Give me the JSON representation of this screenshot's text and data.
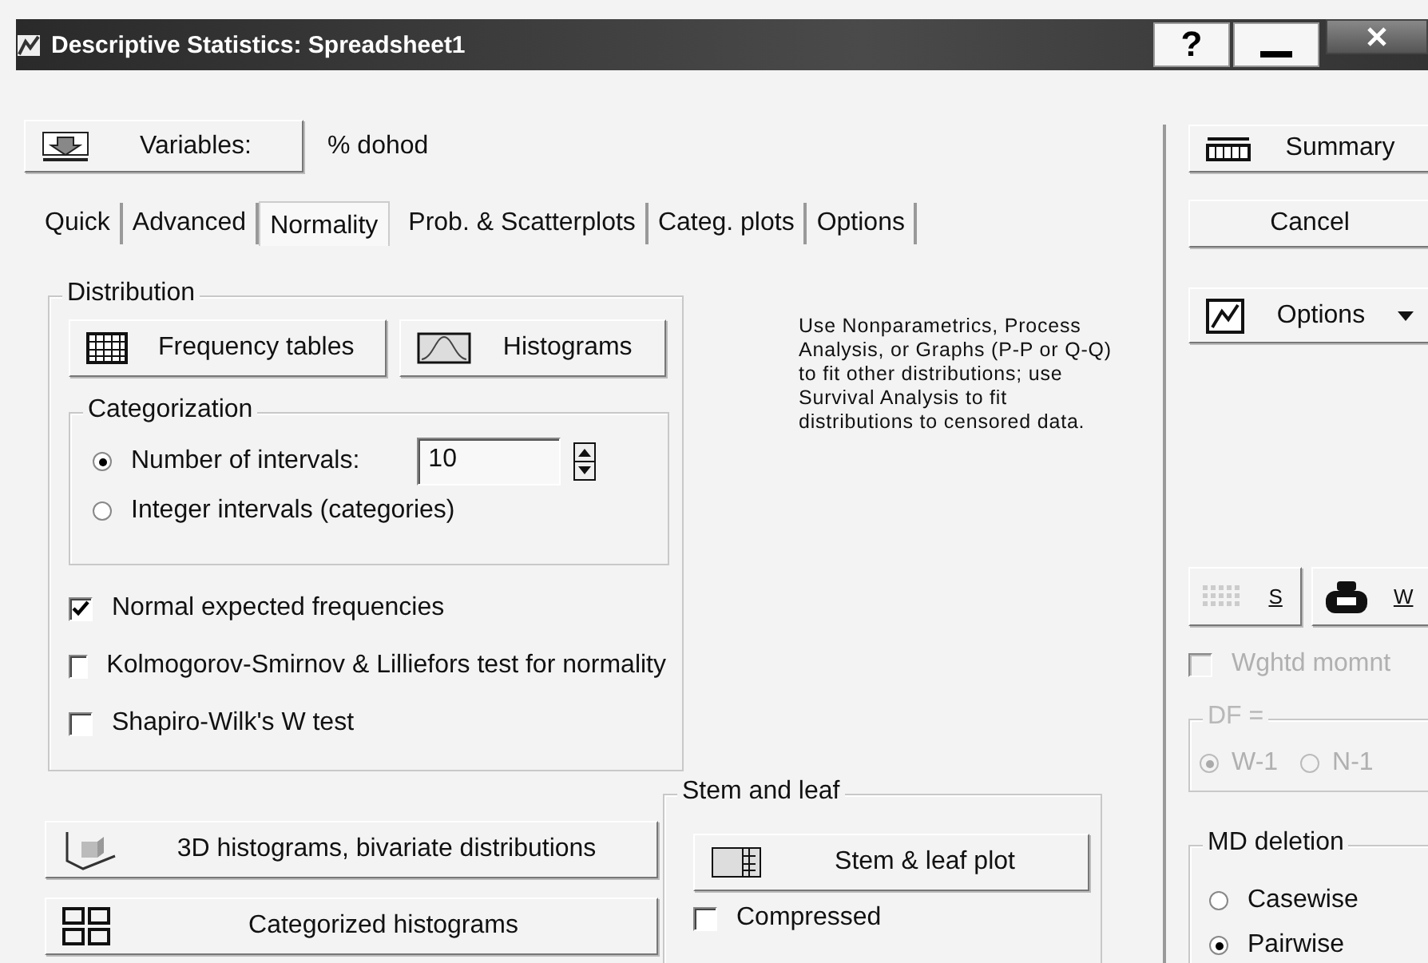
{
  "window": {
    "title": "Descriptive Statistics: Spreadsheet1",
    "help_button": "?"
  },
  "variables_button": "Variables:",
  "variables_value": "% dohod",
  "tabs": [
    {
      "label": "Quick",
      "selected": false
    },
    {
      "label": "Advanced",
      "selected": false
    },
    {
      "label": "Normality",
      "selected": true
    },
    {
      "label": "Prob. & Scatterplots",
      "selected": false
    },
    {
      "label": "Categ. plots",
      "selected": false
    },
    {
      "label": "Options",
      "selected": false
    }
  ],
  "distribution": {
    "title": "Distribution",
    "buttons": [
      "Frequency tables",
      "Histograms"
    ],
    "categorization": {
      "title": "Categorization",
      "intervals": "10",
      "options": [
        {
          "label": "Number of intervals:",
          "selected": true
        },
        {
          "label": "Integer intervals (categories)",
          "selected": false
        }
      ]
    },
    "checks": [
      {
        "label": "Normal expected frequencies",
        "checked": true
      },
      {
        "label": "Kolmogorov-Smirnov & Lilliefors test for normality",
        "checked": false
      },
      {
        "label": "Shapiro-Wilk's W test",
        "checked": false
      }
    ]
  },
  "note": "Use Nonparametrics, Process Analysis, or Graphs (P-P or Q-Q) to fit other distributions; use Survival Analysis to fit distributions to censored data.",
  "buttons": [
    "3D histograms, bivariate distributions",
    "Categorized histograms"
  ],
  "stem_and_leaf": {
    "title": "Stem and leaf",
    "button": "Stem & leaf plot",
    "compressed": {
      "label": "Compressed",
      "checked": false
    }
  },
  "side": {
    "summary": "Summary",
    "cancel": "Cancel",
    "options": "Options",
    "s_button": "S",
    "w_button": "W",
    "weighted": {
      "label": "Wghtd momnt",
      "checked": false,
      "disabled": true
    },
    "df": {
      "title": "DF =",
      "disabled": true,
      "options": [
        {
          "label": "W-1",
          "selected": true
        },
        {
          "label": "N-1",
          "selected": false
        }
      ]
    },
    "md_deletion": {
      "title": "MD deletion",
      "options": [
        {
          "label": "Casewise",
          "selected": false
        },
        {
          "label": "Pairwise",
          "selected": true
        }
      ]
    }
  }
}
